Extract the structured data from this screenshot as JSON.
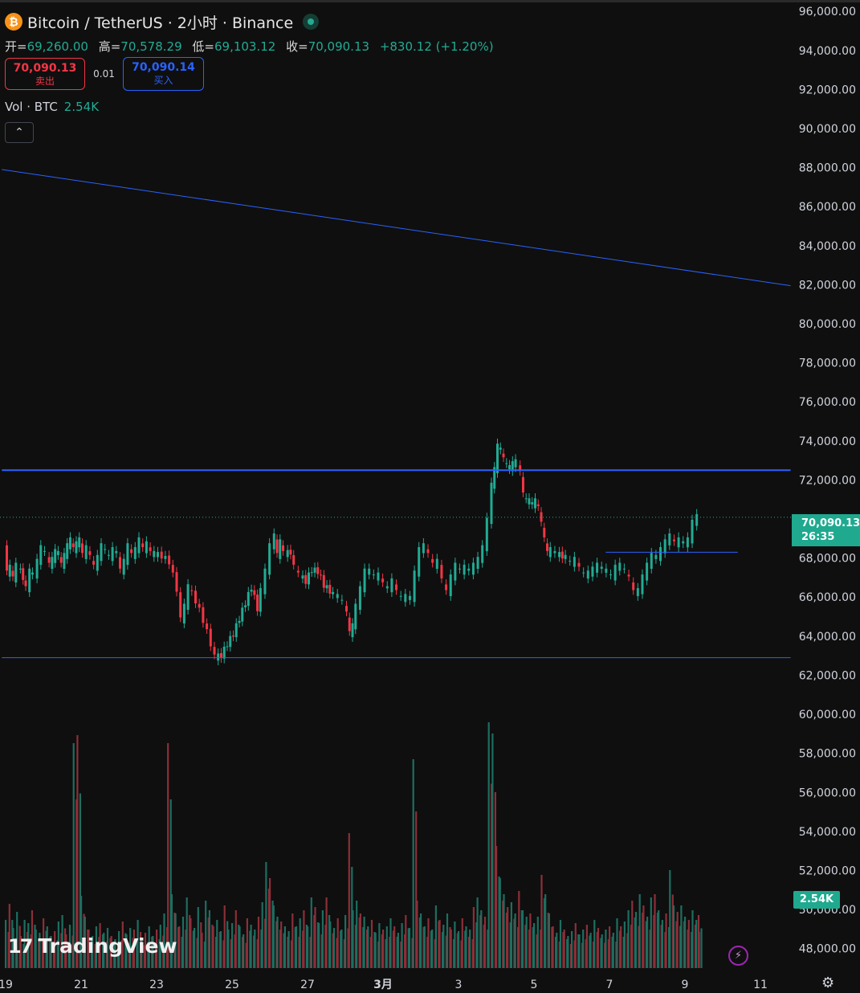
{
  "header": {
    "title": "Bitcoin / TetherUS · 2小时 · Binance",
    "coin_symbol": "₿",
    "ohlc": {
      "open_label": "开=",
      "open": "69,260.00",
      "high_label": "高=",
      "high": "70,578.29",
      "low_label": "低=",
      "low": "69,103.12",
      "close_label": "收=",
      "close": "70,090.13",
      "change": "+830.12 (+1.20%)"
    },
    "sell": {
      "price": "70,090.13",
      "label": "卖出"
    },
    "spread": "0.01",
    "buy": {
      "price": "70,090.14",
      "label": "买入"
    },
    "volume": {
      "label": "Vol · BTC",
      "value": "2.54K"
    },
    "collapse_icon": "chevron-up-icon"
  },
  "last_price_label": {
    "price": "70,090.13",
    "countdown": "26:35"
  },
  "volume_badge": "2.54K",
  "branding": {
    "logo_text": "TradingView",
    "logo_mark": "17"
  },
  "icons": [
    "bitcoin-icon",
    "status-dot-icon",
    "chevron-up-icon",
    "lightning-icon",
    "gear-icon"
  ],
  "colors": {
    "up": "#22ab94",
    "down": "#f23645",
    "line": "#2962ff",
    "background": "#0f0f0f"
  },
  "chart_data": {
    "type": "candlestick",
    "title": "Bitcoin / TetherUS · 2小时 · Binance",
    "ylim": [
      47000,
      96500
    ],
    "y_ticks": [
      "96,000.00",
      "94,000.00",
      "92,000.00",
      "90,000.00",
      "88,000.00",
      "86,000.00",
      "84,000.00",
      "82,000.00",
      "80,000.00",
      "78,000.00",
      "76,000.00",
      "74,000.00",
      "72,000.00",
      "70,000.00",
      "68,000.00",
      "66,000.00",
      "64,000.00",
      "62,000.00",
      "60,000.00",
      "58,000.00",
      "56,000.00",
      "54,000.00",
      "52,000.00",
      "50,000.00",
      "48,000.00"
    ],
    "x_ticks": [
      "19",
      "21",
      "23",
      "25",
      "27",
      "3月",
      "3",
      "5",
      "7",
      "9",
      "11"
    ],
    "path_points": [
      [
        0,
        68800
      ],
      [
        0.04,
        67200
      ],
      [
        0.08,
        67500
      ],
      [
        0.12,
        66900
      ],
      [
        0.18,
        67600
      ],
      [
        0.25,
        67000
      ],
      [
        0.3,
        66400
      ],
      [
        0.34,
        67300
      ],
      [
        0.4,
        67100
      ],
      [
        0.45,
        67800
      ],
      [
        0.5,
        68500
      ],
      [
        0.56,
        68200
      ],
      [
        0.6,
        67600
      ],
      [
        0.64,
        67900
      ],
      [
        0.68,
        68300
      ],
      [
        0.72,
        68200
      ],
      [
        0.76,
        67600
      ],
      [
        0.8,
        68100
      ],
      [
        0.84,
        68600
      ],
      [
        0.88,
        68900
      ],
      [
        0.92,
        68400
      ],
      [
        0.96,
        68700
      ],
      [
        1.0,
        68900
      ],
      [
        1.05,
        68100
      ],
      [
        1.1,
        68500
      ],
      [
        1.15,
        68000
      ],
      [
        1.2,
        67500
      ],
      [
        1.25,
        68000
      ],
      [
        1.3,
        68600
      ],
      [
        1.35,
        68300
      ],
      [
        1.4,
        68000
      ],
      [
        1.45,
        68400
      ],
      [
        1.5,
        68200
      ],
      [
        1.55,
        67300
      ],
      [
        1.6,
        67800
      ],
      [
        1.65,
        68600
      ],
      [
        1.7,
        68100
      ],
      [
        1.75,
        68400
      ],
      [
        1.8,
        68900
      ],
      [
        1.85,
        68400
      ],
      [
        1.9,
        68700
      ],
      [
        1.95,
        68200
      ],
      [
        2.0,
        68200
      ],
      [
        2.1,
        68100
      ],
      [
        2.2,
        67800
      ],
      [
        2.3,
        66400
      ],
      [
        2.35,
        64800
      ],
      [
        2.4,
        65500
      ],
      [
        2.45,
        66500
      ],
      [
        2.55,
        65800
      ],
      [
        2.65,
        64800
      ],
      [
        2.75,
        63600
      ],
      [
        2.8,
        62900
      ],
      [
        2.88,
        63000
      ],
      [
        2.96,
        63600
      ],
      [
        3.04,
        64100
      ],
      [
        3.12,
        64900
      ],
      [
        3.2,
        65700
      ],
      [
        3.28,
        66500
      ],
      [
        3.36,
        65400
      ],
      [
        3.42,
        66300
      ],
      [
        3.48,
        67300
      ],
      [
        3.54,
        68600
      ],
      [
        3.58,
        69100
      ],
      [
        3.62,
        68100
      ],
      [
        3.66,
        68800
      ],
      [
        3.72,
        68200
      ],
      [
        3.8,
        68300
      ],
      [
        3.86,
        67500
      ],
      [
        3.92,
        67100
      ],
      [
        4.0,
        66800
      ],
      [
        4.08,
        67400
      ],
      [
        4.16,
        67300
      ],
      [
        4.24,
        66600
      ],
      [
        4.32,
        66300
      ],
      [
        4.38,
        66100
      ],
      [
        4.44,
        66000
      ],
      [
        4.5,
        65700
      ],
      [
        4.54,
        65100
      ],
      [
        4.58,
        64100
      ],
      [
        4.62,
        64500
      ],
      [
        4.68,
        65500
      ],
      [
        4.74,
        66400
      ],
      [
        4.8,
        67300
      ],
      [
        4.86,
        67300
      ],
      [
        4.92,
        67000
      ],
      [
        4.98,
        67100
      ],
      [
        5.04,
        66600
      ],
      [
        5.1,
        66400
      ],
      [
        5.16,
        66800
      ],
      [
        5.22,
        66200
      ],
      [
        5.28,
        65900
      ],
      [
        5.34,
        66000
      ],
      [
        5.4,
        65900
      ],
      [
        5.46,
        67200
      ],
      [
        5.52,
        68400
      ],
      [
        5.58,
        68600
      ],
      [
        5.64,
        68100
      ],
      [
        5.7,
        67600
      ],
      [
        5.76,
        67800
      ],
      [
        5.82,
        66800
      ],
      [
        5.88,
        66200
      ],
      [
        5.94,
        67000
      ],
      [
        6.0,
        67600
      ],
      [
        6.06,
        67300
      ],
      [
        6.12,
        67500
      ],
      [
        6.18,
        67300
      ],
      [
        6.24,
        67600
      ],
      [
        6.3,
        67900
      ],
      [
        6.36,
        68500
      ],
      [
        6.42,
        69900
      ],
      [
        6.46,
        71700
      ],
      [
        6.5,
        72500
      ],
      [
        6.54,
        73700
      ],
      [
        6.58,
        73500
      ],
      [
        6.62,
        73000
      ],
      [
        6.66,
        72700
      ],
      [
        6.7,
        72600
      ],
      [
        6.74,
        72800
      ],
      [
        6.8,
        72900
      ],
      [
        6.84,
        72300
      ],
      [
        6.88,
        71200
      ],
      [
        6.92,
        70900
      ],
      [
        6.96,
        70900
      ],
      [
        7.0,
        70700
      ],
      [
        7.04,
        70900
      ],
      [
        7.08,
        70500
      ],
      [
        7.12,
        69700
      ],
      [
        7.16,
        68900
      ],
      [
        7.2,
        68200
      ],
      [
        7.26,
        68400
      ],
      [
        7.32,
        68200
      ],
      [
        7.4,
        68100
      ],
      [
        7.46,
        68000
      ],
      [
        7.52,
        67700
      ],
      [
        7.58,
        67900
      ],
      [
        7.64,
        67400
      ],
      [
        7.7,
        67100
      ],
      [
        7.76,
        67200
      ],
      [
        7.82,
        67400
      ],
      [
        7.88,
        67600
      ],
      [
        7.94,
        67400
      ],
      [
        8.0,
        67300
      ],
      [
        8.06,
        67000
      ],
      [
        8.12,
        67500
      ],
      [
        8.18,
        67600
      ],
      [
        8.24,
        67300
      ],
      [
        8.3,
        66900
      ],
      [
        8.36,
        66200
      ],
      [
        8.42,
        66300
      ],
      [
        8.48,
        67000
      ],
      [
        8.54,
        67600
      ],
      [
        8.6,
        68100
      ],
      [
        8.66,
        68000
      ],
      [
        8.72,
        68400
      ],
      [
        8.78,
        68800
      ],
      [
        8.84,
        69100
      ],
      [
        8.9,
        68700
      ],
      [
        8.96,
        68900
      ],
      [
        9.02,
        68700
      ],
      [
        9.08,
        68900
      ],
      [
        9.14,
        69800
      ],
      [
        9.18,
        70090
      ]
    ],
    "series_note_free": true,
    "volume": [
      [
        0,
        3
      ],
      [
        0.05,
        4
      ],
      [
        0.1,
        2.5
      ],
      [
        0.15,
        3.5
      ],
      [
        0.2,
        2
      ],
      [
        0.25,
        3
      ],
      [
        0.3,
        2.8
      ],
      [
        0.35,
        3.6
      ],
      [
        0.4,
        2.4
      ],
      [
        0.45,
        2.2
      ],
      [
        0.5,
        3.1
      ],
      [
        0.55,
        2.6
      ],
      [
        0.6,
        2.0
      ],
      [
        0.65,
        2.3
      ],
      [
        0.7,
        2.9
      ],
      [
        0.75,
        3.3
      ],
      [
        0.8,
        2.1
      ],
      [
        0.85,
        2.7
      ],
      [
        0.9,
        14
      ],
      [
        0.95,
        14.5
      ],
      [
        1.0,
        4.5
      ],
      [
        1.05,
        3.2
      ],
      [
        1.1,
        2.4
      ],
      [
        1.15,
        2.0
      ],
      [
        1.2,
        2.6
      ],
      [
        1.25,
        2.8
      ],
      [
        1.3,
        2.2
      ],
      [
        1.35,
        2.5
      ],
      [
        1.4,
        2.0
      ],
      [
        1.45,
        1.8
      ],
      [
        1.5,
        2.3
      ],
      [
        1.55,
        2.9
      ],
      [
        1.6,
        2.1
      ],
      [
        1.65,
        2.5
      ],
      [
        1.7,
        2.4
      ],
      [
        1.75,
        3.0
      ],
      [
        1.8,
        1.9
      ],
      [
        1.85,
        2.2
      ],
      [
        1.9,
        2.6
      ],
      [
        1.95,
        2.0
      ],
      [
        2.0,
        2.4
      ],
      [
        2.05,
        2.7
      ],
      [
        2.1,
        3.4
      ],
      [
        2.15,
        14
      ],
      [
        2.2,
        4.6
      ],
      [
        2.25,
        3.4
      ],
      [
        2.3,
        2.6
      ],
      [
        2.35,
        3.2
      ],
      [
        2.4,
        4.4
      ],
      [
        2.45,
        3.1
      ],
      [
        2.5,
        2.5
      ],
      [
        2.55,
        3.8
      ],
      [
        2.6,
        2.2
      ],
      [
        2.65,
        4.2
      ],
      [
        2.7,
        3.6
      ],
      [
        2.75,
        2.6
      ],
      [
        2.8,
        3.0
      ],
      [
        2.85,
        2.3
      ],
      [
        2.9,
        3.9
      ],
      [
        2.95,
        2.4
      ],
      [
        3.0,
        2.8
      ],
      [
        3.05,
        3.6
      ],
      [
        3.1,
        2.6
      ],
      [
        3.15,
        2.1
      ],
      [
        3.2,
        3.1
      ],
      [
        3.25,
        2.7
      ],
      [
        3.3,
        2.4
      ],
      [
        3.35,
        3.2
      ],
      [
        3.4,
        4.1
      ],
      [
        3.45,
        6.6
      ],
      [
        3.5,
        5.6
      ],
      [
        3.55,
        3.9
      ],
      [
        3.6,
        3.2
      ],
      [
        3.65,
        2.9
      ],
      [
        3.7,
        2.6
      ],
      [
        3.75,
        2.3
      ],
      [
        3.8,
        3.4
      ],
      [
        3.85,
        2.6
      ],
      [
        3.9,
        3.1
      ],
      [
        3.95,
        3.6
      ],
      [
        4.0,
        2.6
      ],
      [
        4.05,
        4.4
      ],
      [
        4.1,
        3.8
      ],
      [
        4.15,
        2.8
      ],
      [
        4.2,
        3.6
      ],
      [
        4.25,
        4.4
      ],
      [
        4.3,
        2.9
      ],
      [
        4.35,
        2.5
      ],
      [
        4.4,
        3.1
      ],
      [
        4.45,
        2.4
      ],
      [
        4.5,
        3.3
      ],
      [
        4.55,
        8.4
      ],
      [
        4.6,
        3.6
      ],
      [
        4.65,
        4.2
      ],
      [
        4.7,
        3.4
      ],
      [
        4.75,
        3.2
      ],
      [
        4.8,
        2.6
      ],
      [
        4.85,
        3.0
      ],
      [
        4.9,
        2.2
      ],
      [
        4.95,
        2.8
      ],
      [
        5.0,
        2.4
      ],
      [
        5.05,
        2.6
      ],
      [
        5.1,
        3.1
      ],
      [
        5.15,
        2.6
      ],
      [
        5.2,
        2.2
      ],
      [
        5.25,
        2.8
      ],
      [
        5.3,
        3.3
      ],
      [
        5.35,
        2.5
      ],
      [
        5.4,
        13
      ],
      [
        5.45,
        4.2
      ],
      [
        5.5,
        3.4
      ],
      [
        5.55,
        2.6
      ],
      [
        5.6,
        3.1
      ],
      [
        5.65,
        2.4
      ],
      [
        5.7,
        3.9
      ],
      [
        5.75,
        3.0
      ],
      [
        5.8,
        2.7
      ],
      [
        5.85,
        3.4
      ],
      [
        5.9,
        2.4
      ],
      [
        5.95,
        2.9
      ],
      [
        6.0,
        2.3
      ],
      [
        6.05,
        3.1
      ],
      [
        6.1,
        2.6
      ],
      [
        6.15,
        2.4
      ],
      [
        6.2,
        3.8
      ],
      [
        6.25,
        4.4
      ],
      [
        6.3,
        3.6
      ],
      [
        6.35,
        3.2
      ],
      [
        6.4,
        15.3
      ],
      [
        6.45,
        14.6
      ],
      [
        6.5,
        7.6
      ],
      [
        6.55,
        5.6
      ],
      [
        6.6,
        4.6
      ],
      [
        6.65,
        3.8
      ],
      [
        6.7,
        4.1
      ],
      [
        6.75,
        3.4
      ],
      [
        6.8,
        4.8
      ],
      [
        6.85,
        3.6
      ],
      [
        6.9,
        3.2
      ],
      [
        6.95,
        3.4
      ],
      [
        7.0,
        2.8
      ],
      [
        7.05,
        3.2
      ],
      [
        7.1,
        5.8
      ],
      [
        7.15,
        4.6
      ],
      [
        7.2,
        3.4
      ],
      [
        7.25,
        2.6
      ],
      [
        7.3,
        2.2
      ],
      [
        7.35,
        3.0
      ],
      [
        7.4,
        2.4
      ],
      [
        7.45,
        2.0
      ],
      [
        7.5,
        2.3
      ],
      [
        7.55,
        2.8
      ],
      [
        7.6,
        2.1
      ],
      [
        7.65,
        2.4
      ],
      [
        7.7,
        2.7
      ],
      [
        7.75,
        2.2
      ],
      [
        7.8,
        3.0
      ],
      [
        7.85,
        2.5
      ],
      [
        7.9,
        2.1
      ],
      [
        7.95,
        2.4
      ],
      [
        8.0,
        2.6
      ],
      [
        8.05,
        2.2
      ],
      [
        8.1,
        3.1
      ],
      [
        8.15,
        2.6
      ],
      [
        8.2,
        2.9
      ],
      [
        8.25,
        3.6
      ],
      [
        8.3,
        4.2
      ],
      [
        8.35,
        3.5
      ],
      [
        8.4,
        4.6
      ],
      [
        8.45,
        3.9
      ],
      [
        8.5,
        3.2
      ],
      [
        8.55,
        4.4
      ],
      [
        8.6,
        4.6
      ],
      [
        8.65,
        3.6
      ],
      [
        8.7,
        3.0
      ],
      [
        8.75,
        3.4
      ],
      [
        8.8,
        6.1
      ],
      [
        8.85,
        3.9
      ],
      [
        8.9,
        3.5
      ],
      [
        8.95,
        3.9
      ],
      [
        9.0,
        3.2
      ],
      [
        9.05,
        3.0
      ],
      [
        9.1,
        3.6
      ],
      [
        9.15,
        3.0
      ],
      [
        9.18,
        3.3
      ]
    ],
    "trend_lines": [
      {
        "from": [
          -0.05,
          87900
        ],
        "to": [
          10.4,
          81950
        ]
      },
      {
        "from": [
          -0.05,
          72500
        ],
        "to": [
          10.4,
          72500
        ]
      },
      {
        "from": [
          -0.05,
          62900
        ],
        "to": [
          10.4,
          62900
        ]
      },
      {
        "from": [
          7.95,
          68300
        ],
        "to": [
          9.7,
          68300
        ]
      }
    ],
    "last_price": 70090.13
  }
}
